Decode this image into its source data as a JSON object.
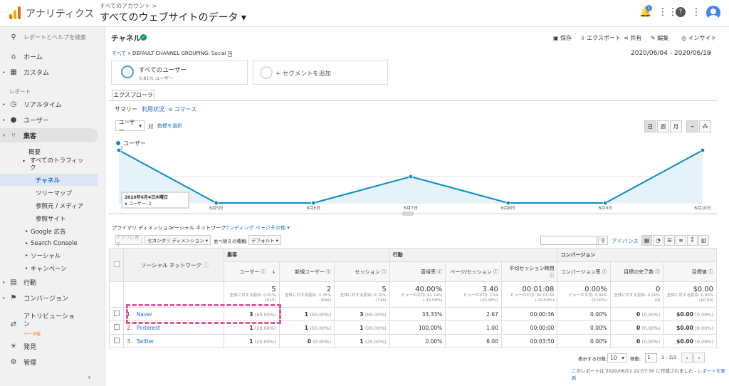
{
  "topbar": {
    "app_title": "アナリティクス",
    "account_small": "すべてのアカウント >",
    "property": "すべてのウェブサイトのデータ ▾",
    "notif_count": "1"
  },
  "sidebar": {
    "search": "レポートとヘルプを検索",
    "home": "ホーム",
    "custom": "カスタム",
    "reports_section": "レポート",
    "realtime": "リアルタイム",
    "users": "ユーザー",
    "acquisition": "集客",
    "overview": "概要",
    "all_traffic": "すべてのトラフィック",
    "channels": "チャネル",
    "treemap": "ツリーマップ",
    "referral": "参照元 / メディア",
    "referral_sites": "参照サイト",
    "google_ads": "Google 広告",
    "search_console": "Search Console",
    "social": "ソーシャル",
    "campaigns": "キャンペーン",
    "behavior": "行動",
    "conversions": "コンバージョン",
    "attribution": "アトリビューション",
    "beta": "ベータ版",
    "discover": "発見",
    "admin": "管理"
  },
  "report": {
    "title": "チャネル",
    "actions": [
      "保存",
      "エクスポート",
      "共有",
      "編集",
      "インサイト"
    ],
    "breadcrumb_all": "すべて",
    "breadcrumb_rest": "» DEFAULT CHANNEL GROUPING: Social",
    "date_range": "2020/06/04 - 2020/06/10",
    "segment_name": "すべてのユーザー",
    "segment_pct": "0.81% ユーザー",
    "add_segment": "+ セグメントを追加",
    "tab": "エクスプローラ",
    "subtabs": [
      "サマリー",
      "利用状況",
      "e コマース"
    ],
    "metric_select": "ユーザー",
    "vs": "対",
    "select_metric": "指標を選択",
    "granularity": [
      "日",
      "週",
      "月"
    ],
    "legend": "ユーザー"
  },
  "chart_data": {
    "type": "area",
    "series": [
      {
        "name": "ユーザー",
        "values": [
          2,
          0,
          0,
          1,
          0,
          0,
          2
        ]
      }
    ],
    "categories": [
      "6月4日",
      "6月5日",
      "6月6日",
      "6月7日",
      "6月8日",
      "6月9日",
      "6月10日"
    ],
    "x_ticks": [
      "6月5日",
      "6月6日",
      "6月7日",
      "6月8日",
      "6月9日",
      "6月10日"
    ],
    "y_ticks": [
      "2",
      "1"
    ],
    "ylim": [
      0,
      2
    ],
    "tooltip": {
      "date": "2020年6月4日木曜日",
      "label": "ユーザー: 2"
    },
    "color": "#058dc7"
  },
  "table": {
    "primary_dim_label": "プライマリ ディメンション:",
    "primary_dim": "ソーシャル ネットワーク",
    "landing": "ランディング ページ",
    "other": "その他 ▾",
    "plot_rows": "グラフに表示",
    "secondary_dim": "セカンダリ ディメンション ▾",
    "sort_type": "並べ替えの種類:",
    "default": "デフォルト ▾",
    "advanced": "アドバンス",
    "group_acq": "集客",
    "group_beh": "行動",
    "group_conv": "コンバージョン",
    "dim_header": "ソーシャル ネットワーク",
    "columns": [
      "ユーザー",
      "新規ユーザー",
      "セッション",
      "直帰率",
      "ページ/セッション",
      "平均セッション時間",
      "コンバージョン率",
      "目標の完了数",
      "目標値"
    ],
    "totals": [
      {
        "v": "5",
        "s": "全体に対する割合: 0.81% (615)"
      },
      {
        "v": "2",
        "s": "全体に対する割合: 0.35% (566)"
      },
      {
        "v": "5",
        "s": "全体に対する割合: 0.70% (718)"
      },
      {
        "v": "40.00%",
        "s": "ビューの平均: 61.14% (-34.58%)"
      },
      {
        "v": "3.40",
        "s": "ビューの平均: 2.54 (33.98%)"
      },
      {
        "v": "00:01:08",
        "s": "ビューの平均: 00:01:30 (-24.50%)"
      },
      {
        "v": "0.00%",
        "s": "ビューの平均: 0.00% (0.00%)"
      },
      {
        "v": "0",
        "s": "全体に対する割合: 0.00% (0)"
      },
      {
        "v": "$0.00",
        "s": "全体に対する割合: 0.00% ($0.00)"
      }
    ],
    "rows": [
      {
        "n": "1.",
        "name": "Naver",
        "u": "3",
        "up": "(60.00%)",
        "nu": "1",
        "nup": "(50.00%)",
        "s": "3",
        "sp": "(60.00%)",
        "b": "33.33%",
        "pps": "2.67",
        "dur": "00:00:36",
        "cr": "0.00%",
        "gc": "0",
        "gcp": "(0.00%)",
        "gv": "$0.00",
        "gvp": "(0.00%)"
      },
      {
        "n": "2.",
        "name": "Pinterest",
        "u": "1",
        "up": "(20.00%)",
        "nu": "1",
        "nup": "(50.00%)",
        "s": "1",
        "sp": "(20.00%)",
        "b": "100.00%",
        "pps": "1.00",
        "dur": "00:00:00",
        "cr": "0.00%",
        "gc": "0",
        "gcp": "(0.00%)",
        "gv": "$0.00",
        "gvp": "(0.00%)"
      },
      {
        "n": "3.",
        "name": "Twitter",
        "u": "1",
        "up": "(20.00%)",
        "nu": "0",
        "nup": "(0.00%)",
        "s": "1",
        "sp": "(20.00%)",
        "b": "0.00%",
        "pps": "8.00",
        "dur": "00:03:50",
        "cr": "0.00%",
        "gc": "0",
        "gcp": "(0.00%)",
        "gv": "$0.00",
        "gvp": "(0.00%)"
      }
    ],
    "show_rows": "表示する行数:",
    "rows_value": "10",
    "goto": "移動:",
    "goto_value": "1",
    "range": "1 - 3/3",
    "footer": "このレポートは 2020/06/11 22:57:30 に作成されました - ",
    "refresh": "レポートを更新"
  }
}
